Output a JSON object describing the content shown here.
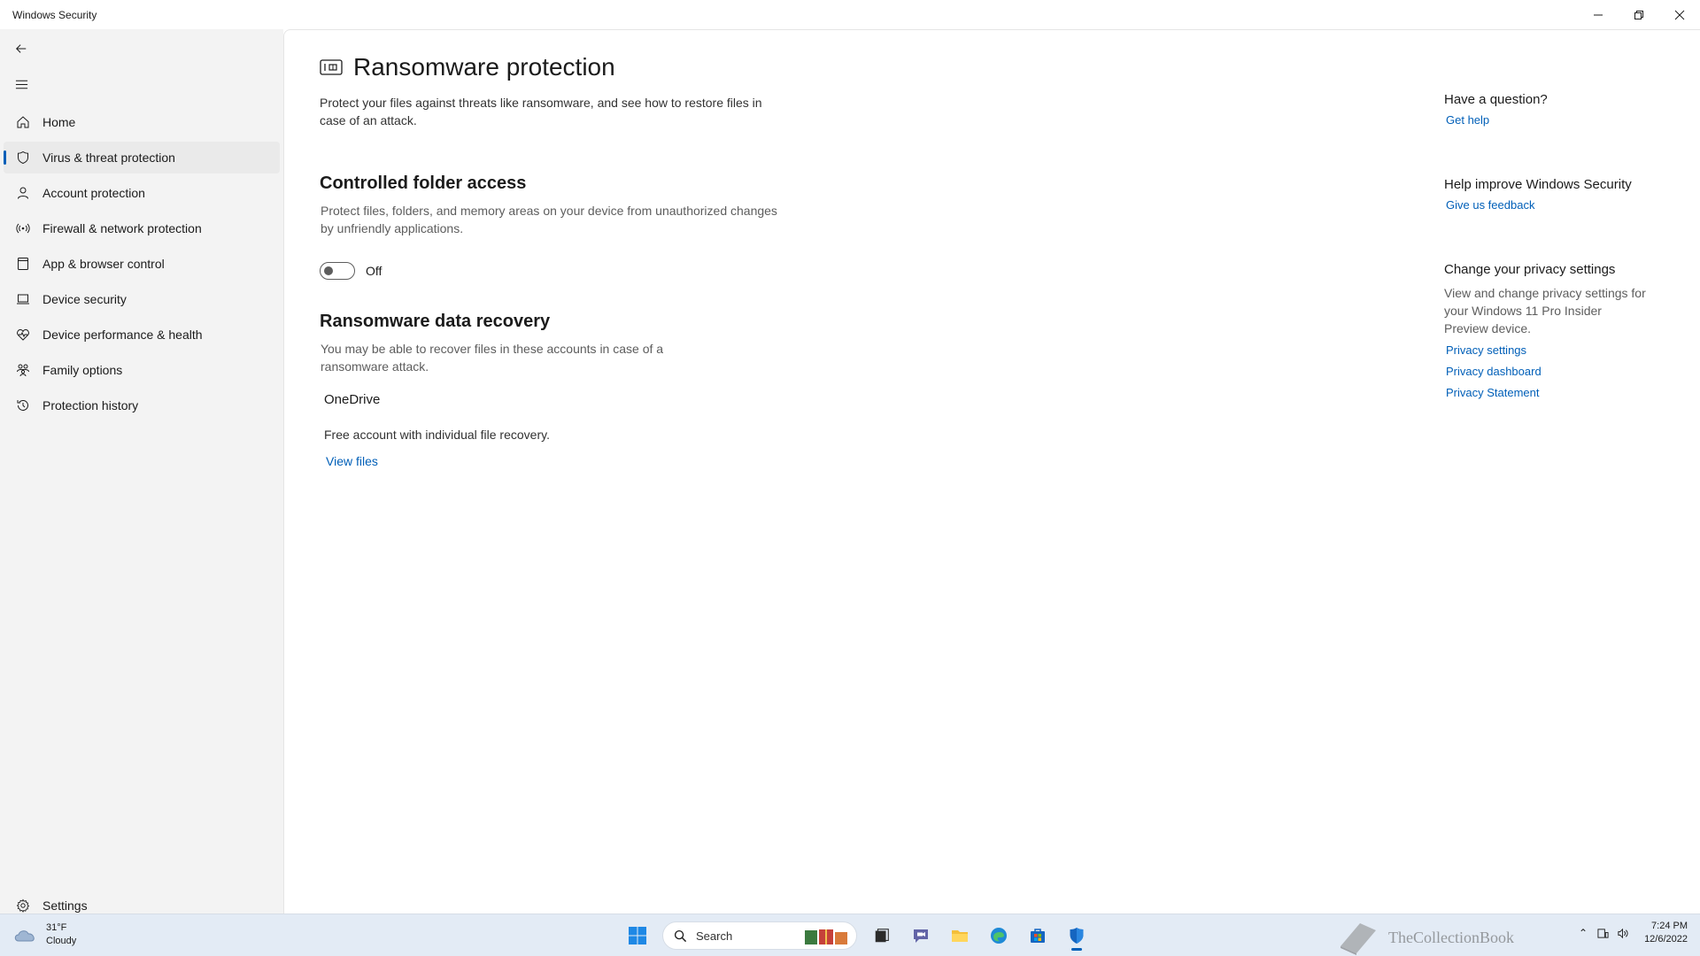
{
  "window": {
    "title": "Windows Security",
    "minimize": "minimize",
    "restore": "restore",
    "close": "close"
  },
  "sidebar": {
    "back_label": "Back",
    "menu_label": "Menu",
    "items": [
      {
        "label": "Home",
        "icon": "home-icon"
      },
      {
        "label": "Virus & threat protection",
        "icon": "shield-icon",
        "active": true
      },
      {
        "label": "Account protection",
        "icon": "person-icon"
      },
      {
        "label": "Firewall & network protection",
        "icon": "antenna-icon"
      },
      {
        "label": "App & browser control",
        "icon": "app-window-icon"
      },
      {
        "label": "Device security",
        "icon": "laptop-icon"
      },
      {
        "label": "Device performance & health",
        "icon": "heart-pulse-icon"
      },
      {
        "label": "Family options",
        "icon": "family-icon"
      },
      {
        "label": "Protection history",
        "icon": "history-icon"
      }
    ],
    "settings_label": "Settings"
  },
  "main": {
    "title": "Ransomware protection",
    "description": "Protect your files against threats like ransomware, and see how to restore files in case of an attack.",
    "controlled_folder": {
      "title": "Controlled folder access",
      "description": "Protect files, folders, and memory areas on your device from unauthorized changes by unfriendly applications.",
      "toggle_state": "Off"
    },
    "data_recovery": {
      "title": "Ransomware data recovery",
      "description": "You may be able to recover files in these accounts in case of a ransomware attack.",
      "account_name": "OneDrive",
      "account_desc": "Free account with individual file recovery.",
      "view_files": "View files"
    }
  },
  "right_column": {
    "question": {
      "title": "Have a question?",
      "link": "Get help"
    },
    "improve": {
      "title": "Help improve Windows Security",
      "link": "Give us feedback"
    },
    "privacy": {
      "title": "Change your privacy settings",
      "text": "View and change privacy settings for your Windows 11 Pro Insider Preview device.",
      "links": [
        "Privacy settings",
        "Privacy dashboard",
        "Privacy Statement"
      ]
    }
  },
  "taskbar": {
    "weather_temp": "31°F",
    "weather_cond": "Cloudy",
    "search_label": "Search",
    "time": "7:24 PM",
    "date": "12/6/2022",
    "watermark": "TheCollectionBook",
    "accent": "#005fb8"
  }
}
